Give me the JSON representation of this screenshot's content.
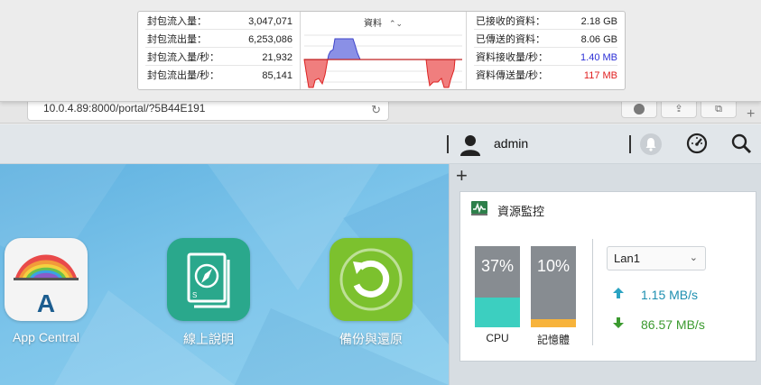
{
  "activity_monitor": {
    "packets": [
      {
        "label": "封包流入量：",
        "value": "3,047,071"
      },
      {
        "label": "封包流出量：",
        "value": "6,253,086"
      },
      {
        "label": "封包流入量/秒：",
        "value": "21,932"
      },
      {
        "label": "封包流出量/秒：",
        "value": "85,141"
      }
    ],
    "data_selector": "資料",
    "data": [
      {
        "label": "已接收的資料：",
        "value": "2.18 GB"
      },
      {
        "label": "已傳送的資料：",
        "value": "8.06 GB"
      },
      {
        "label": "資料接收量/秒：",
        "value": "1.40 MB"
      },
      {
        "label": "資料傳送量/秒：",
        "value": "117 MB"
      }
    ],
    "colors": {
      "received": "#2b2fd6",
      "sent": "#e01e1e",
      "graph_in": "#8a90e6",
      "graph_out": "#f07e7e"
    }
  },
  "browser": {
    "url": "10.0.4.89:8000/portal/?5B44E191",
    "reload_icon": "reload-icon",
    "new_tab_label": "+"
  },
  "header": {
    "username": "admin",
    "icons": [
      "user-avatar-icon",
      "bell-icon",
      "dashboard-icon",
      "search-icon"
    ]
  },
  "desktop": {
    "apps": [
      {
        "label": "App Central",
        "icon": "app-central-icon"
      },
      {
        "label": "線上說明",
        "icon": "online-help-icon"
      },
      {
        "label": "備份與還原",
        "icon": "backup-restore-icon"
      }
    ]
  },
  "widget": {
    "add_label": "+",
    "title": "資源監控",
    "cpu": {
      "label": "CPU",
      "percent_text": "37%",
      "level": 0.37,
      "color": "#3ccfc0"
    },
    "memory": {
      "label": "記憶體",
      "percent_text": "10%",
      "level": 0.1,
      "color": "#f7b33b"
    },
    "network": {
      "interface": "Lan1",
      "upload": "1.15 MB/s",
      "download": "86.57 MB/s",
      "upload_color": "#1e8fb0",
      "download_color": "#3b9a2f"
    }
  }
}
